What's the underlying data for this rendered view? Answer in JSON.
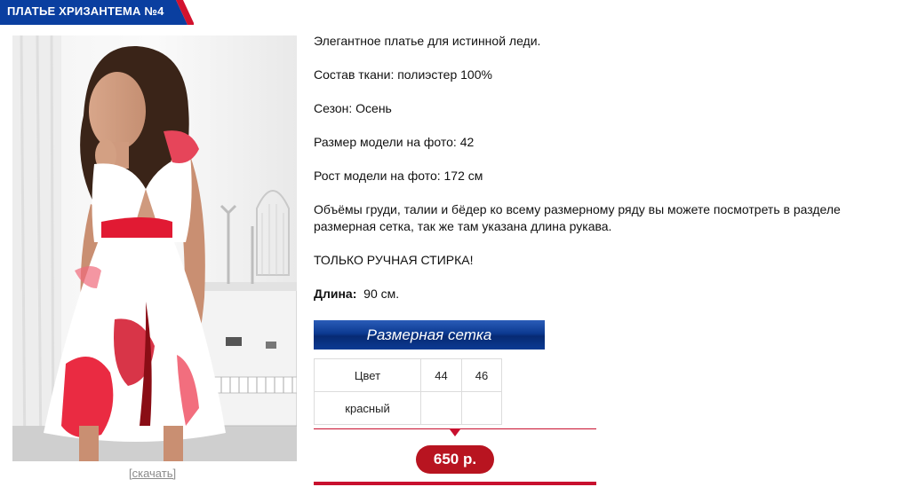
{
  "product": {
    "title": "ПЛАТЬЕ ХРИЗАНТЕМА №4",
    "download_label": "[скачать]",
    "description": [
      "Элегантное платье для истинной леди.",
      "Состав ткани: полиэстер 100%",
      "Сезон: Осень",
      "Размер модели на фото: 42",
      "Рост модели на фото: 172 см",
      "Объёмы груди, талии и бёдер ко всему размерному ряду вы можете посмотреть в разделе размерная сетка, так же там указана длина рукава.",
      "ТОЛЬКО РУЧНАЯ СТИРКА!"
    ],
    "length_label": "Длина:",
    "length_value": "90 см.",
    "price": "650 р."
  },
  "size_chart": {
    "header": "Размерная сетка",
    "col_color": "Цвет",
    "sizes": [
      "44",
      "46"
    ],
    "rows": [
      {
        "color": "красный",
        "cells": [
          "",
          ""
        ]
      }
    ]
  },
  "colors": {
    "banner_blue": "#0a3fa0",
    "banner_red": "#d2122e",
    "price_red": "#b81420"
  }
}
